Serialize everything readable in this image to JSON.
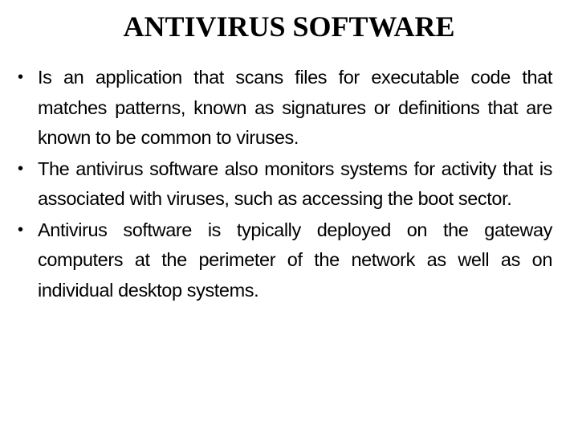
{
  "slide": {
    "title": "ANTIVIRUS SOFTWARE",
    "bullet_glyph": "•",
    "bullets": [
      {
        "text": "Is an application that scans files for executable code that matches patterns, known as signatures or definitions that are known to be common to viruses."
      },
      {
        "text": "The antivirus software also monitors systems for activity that is associated with viruses, such as accessing the boot sector."
      },
      {
        "text": "Antivirus software is typically deployed on the gateway computers at the perimeter of the network as well as on individual desktop systems."
      }
    ]
  }
}
